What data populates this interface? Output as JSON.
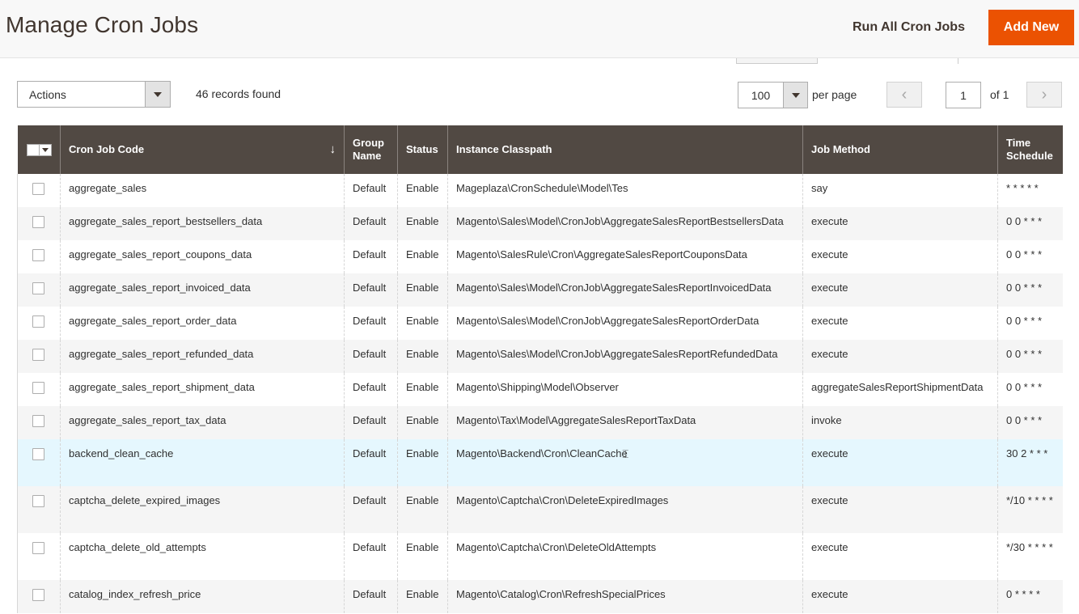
{
  "header": {
    "title": "Manage Cron Jobs",
    "run_all_label": "Run All Cron Jobs",
    "add_new_label": "Add New"
  },
  "toolbar": {
    "actions_label": "Actions",
    "records_found": "46 records found",
    "per_page_value": "100",
    "per_page_label": "per page",
    "current_page": "1",
    "page_of": "of 1",
    "prev_icon": "chevron-left-icon",
    "next_icon": "chevron-right-icon"
  },
  "grid": {
    "columns": [
      {
        "key": "select",
        "label": ""
      },
      {
        "key": "code",
        "label": "Cron Job Code",
        "sorted": "desc"
      },
      {
        "key": "group",
        "label": "Group Name"
      },
      {
        "key": "status",
        "label": "Status"
      },
      {
        "key": "classpath",
        "label": "Instance Classpath"
      },
      {
        "key": "method",
        "label": "Job Method"
      },
      {
        "key": "schedule",
        "label": "Time Schedule"
      }
    ],
    "sort_icon": "arrow-down-icon",
    "rows": [
      {
        "code": "aggregate_sales",
        "group": "Default",
        "status": "Enable",
        "classpath": "Mageplaza\\CronSchedule\\Model\\Tes",
        "method": "say",
        "schedule": "* * * * *"
      },
      {
        "code": "aggregate_sales_report_bestsellers_data",
        "group": "Default",
        "status": "Enable",
        "classpath": "Magento\\Sales\\Model\\CronJob\\AggregateSalesReportBestsellersData",
        "method": "execute",
        "schedule": "0 0 * * *"
      },
      {
        "code": "aggregate_sales_report_coupons_data",
        "group": "Default",
        "status": "Enable",
        "classpath": "Magento\\SalesRule\\Cron\\AggregateSalesReportCouponsData",
        "method": "execute",
        "schedule": "0 0 * * *"
      },
      {
        "code": "aggregate_sales_report_invoiced_data",
        "group": "Default",
        "status": "Enable",
        "classpath": "Magento\\Sales\\Model\\CronJob\\AggregateSalesReportInvoicedData",
        "method": "execute",
        "schedule": "0 0 * * *"
      },
      {
        "code": "aggregate_sales_report_order_data",
        "group": "Default",
        "status": "Enable",
        "classpath": "Magento\\Sales\\Model\\CronJob\\AggregateSalesReportOrderData",
        "method": "execute",
        "schedule": "0 0 * * *"
      },
      {
        "code": "aggregate_sales_report_refunded_data",
        "group": "Default",
        "status": "Enable",
        "classpath": "Magento\\Sales\\Model\\CronJob\\AggregateSalesReportRefundedData",
        "method": "execute",
        "schedule": "0 0 * * *"
      },
      {
        "code": "aggregate_sales_report_shipment_data",
        "group": "Default",
        "status": "Enable",
        "classpath": "Magento\\Shipping\\Model\\Observer",
        "method": "aggregateSalesReportShipmentData",
        "schedule": "0 0 * * *"
      },
      {
        "code": "aggregate_sales_report_tax_data",
        "group": "Default",
        "status": "Enable",
        "classpath": "Magento\\Tax\\Model\\AggregateSalesReportTaxData",
        "method": "invoke",
        "schedule": "0 0 * * *"
      },
      {
        "code": "backend_clean_cache",
        "group": "Default",
        "status": "Enable",
        "classpath": "Magento\\Backend\\Cron\\CleanCache",
        "method": "execute",
        "schedule": "30 2 * * *"
      },
      {
        "code": "captcha_delete_expired_images",
        "group": "Default",
        "status": "Enable",
        "classpath": "Magento\\Captcha\\Cron\\DeleteExpiredImages",
        "method": "execute",
        "schedule": "*/10 * * * *"
      },
      {
        "code": "captcha_delete_old_attempts",
        "group": "Default",
        "status": "Enable",
        "classpath": "Magento\\Captcha\\Cron\\DeleteOldAttempts",
        "method": "execute",
        "schedule": "*/30 * * * *"
      },
      {
        "code": "catalog_index_refresh_price",
        "group": "Default",
        "status": "Enable",
        "classpath": "Magento\\Catalog\\Cron\\RefreshSpecialPrices",
        "method": "execute",
        "schedule": "0 * * * *"
      }
    ]
  }
}
